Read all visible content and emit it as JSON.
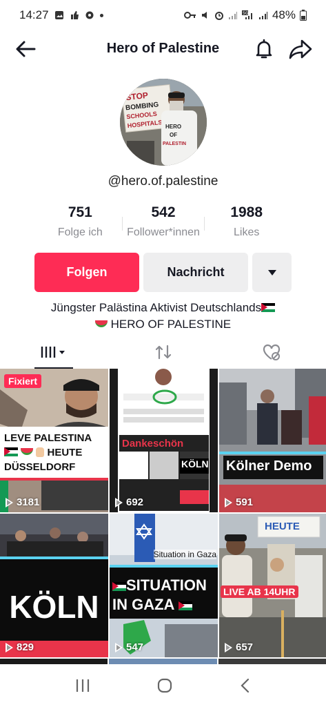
{
  "status_bar": {
    "time": "14:27",
    "battery": "48%"
  },
  "header": {
    "title": "Hero of Palestine"
  },
  "profile": {
    "username": "@hero.of.palestine",
    "avatar_sign_text": "STOP BOMBING SCHOOLS AND HOSPITALS",
    "avatar_shirt_text": "HERO OF PALESTINE"
  },
  "stats": [
    {
      "value": "751",
      "label": "Folge ich"
    },
    {
      "value": "542",
      "label": "Follower*innen"
    },
    {
      "value": "1988",
      "label": "Likes"
    }
  ],
  "actions": {
    "follow_label": "Folgen",
    "message_label": "Nachricht"
  },
  "bio": {
    "line1": "Jüngster Palästina Aktivist Deutschlands",
    "line2": "HERO OF PALESTINE"
  },
  "videos": [
    {
      "views": "3181",
      "pinned_label": "Fixiert",
      "caption": "LEVE PALESTINA",
      "caption2": "HEUTE",
      "caption3": "DÜSSELDORF"
    },
    {
      "views": "692",
      "caption": "Dankeschön",
      "caption2": "KÖLN"
    },
    {
      "views": "591",
      "caption": "Kölner Demo"
    },
    {
      "views": "829",
      "caption": "KÖLN"
    },
    {
      "views": "547",
      "caption": "SITUATION",
      "caption2": "IN GAZA",
      "top_label": "Situation in Gaza"
    },
    {
      "views": "657",
      "caption": "LIVE AB 14UHR",
      "sign": "HEUTE"
    }
  ],
  "colors": {
    "accent": "#fe2c55",
    "secondary_button": "#eeeeef",
    "muted_text": "#8a8b91"
  }
}
